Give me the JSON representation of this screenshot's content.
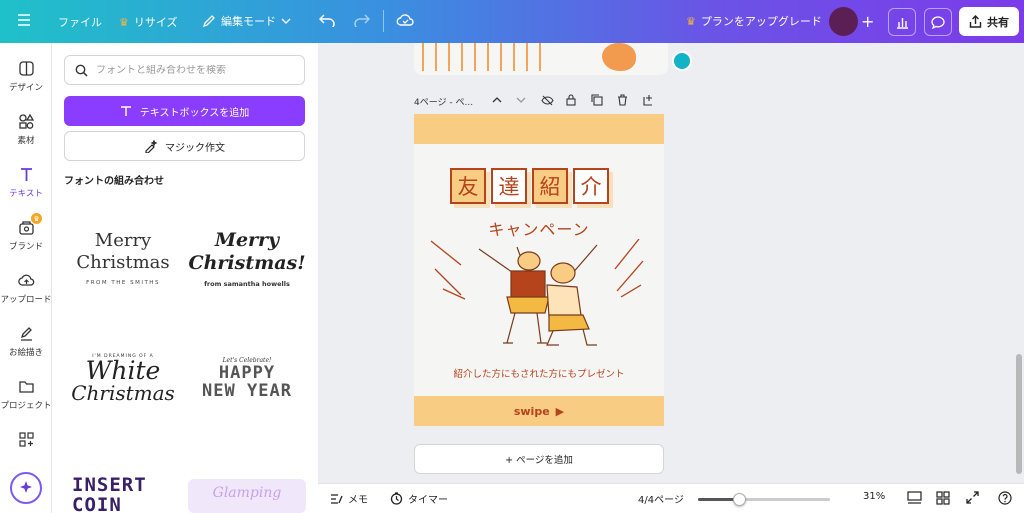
{
  "colors": {
    "accent": "#8b3dff",
    "poster_orange": "#b5431c",
    "poster_band": "#f9cc83",
    "avatar": "#5c1f55"
  },
  "topbar": {
    "file": "ファイル",
    "resize": "リサイズ",
    "edit_mode": "編集モード",
    "upgrade": "プランをアップグレード",
    "share": "共有",
    "icons": [
      "menu-icon",
      "undo-icon",
      "redo-icon",
      "cloud-save-icon",
      "chart-icon",
      "comment-icon",
      "share-icon"
    ]
  },
  "rail": {
    "items": [
      {
        "label": "デザイン",
        "icon": "design-icon"
      },
      {
        "label": "素材",
        "icon": "elements-icon"
      },
      {
        "label": "テキスト",
        "icon": "text-icon"
      },
      {
        "label": "ブランド",
        "icon": "brand-icon"
      },
      {
        "label": "アップロード",
        "icon": "upload-icon"
      },
      {
        "label": "お絵描き",
        "icon": "draw-icon"
      },
      {
        "label": "プロジェクト",
        "icon": "folder-icon"
      }
    ]
  },
  "panel": {
    "search_placeholder": "フォントと組み合わせを検索",
    "add_textbox": "テキストボックスを追加",
    "magic_write": "マジック作文",
    "section_title": "フォントの組み合わせ",
    "combos": {
      "merry1": {
        "line1": "Merry",
        "line2": "Christmas",
        "sub": "FROM THE SMITHS"
      },
      "merry2": {
        "line1": "Merry",
        "line2": "Christmas!",
        "sub": "from samantha howells"
      },
      "white": {
        "pre": "I'M DREAMING OF A",
        "line1": "White",
        "line2": "Christmas"
      },
      "happy": {
        "pre": "Let's Celebrate!",
        "line1": "HAPPY",
        "line2": "NEW YEAR"
      },
      "insert": {
        "line1": "INSERT",
        "line2": "COIN"
      },
      "glow": {
        "text": "Glamping"
      }
    }
  },
  "canvas": {
    "page_label": "4ページ - ペ...",
    "poster": {
      "kanji": [
        "友",
        "達",
        "紹",
        "介"
      ],
      "campaign": "キャンペーン",
      "promo": "紹介した方にもされた方にもプレゼント",
      "swipe": "swipe"
    },
    "add_page": "+ ページを追加"
  },
  "bottombar": {
    "notes": "メモ",
    "timer": "タイマー",
    "page_count": "4/4ページ",
    "zoom": "31%",
    "zoom_fraction": 0.31
  }
}
